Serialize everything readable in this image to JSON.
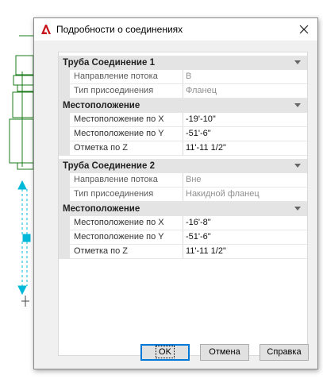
{
  "dialog": {
    "title": "Подробности о соединениях",
    "close_glyph": "✕",
    "app_icon": "autocad-a-icon"
  },
  "connection1": {
    "header": "Труба Соединение 1",
    "rows": [
      {
        "label": "Направление потока",
        "value": "В"
      },
      {
        "label": "Тип присоединения",
        "value": "Фланец"
      }
    ],
    "location": {
      "header": "Местоположение",
      "rows": [
        {
          "label": "Местоположение по X",
          "value": "-19'-10\""
        },
        {
          "label": "Местоположение по Y",
          "value": "-51'-6\""
        },
        {
          "label": "Отметка по Z",
          "value": "11'-11 1/2\""
        }
      ]
    }
  },
  "connection2": {
    "header": "Труба Соединение 2",
    "rows": [
      {
        "label": "Направление потока",
        "value": "Вне"
      },
      {
        "label": "Тип присоединения",
        "value": "Накидной фланец"
      }
    ],
    "location": {
      "header": "Местоположение",
      "rows": [
        {
          "label": "Местоположение по X",
          "value": "-16'-8\""
        },
        {
          "label": "Местоположение по Y",
          "value": "-51'-6\""
        },
        {
          "label": "Отметка по Z",
          "value": "11'-11 1/2\""
        }
      ]
    }
  },
  "buttons": {
    "ok": "OK",
    "cancel": "Отмена",
    "help": "Справка"
  },
  "colors": {
    "drawing_green": "#1b7a1b",
    "drawing_cyan": "#00b8d8",
    "focus_blue": "#0078d7",
    "app_red": "#c8161d"
  }
}
